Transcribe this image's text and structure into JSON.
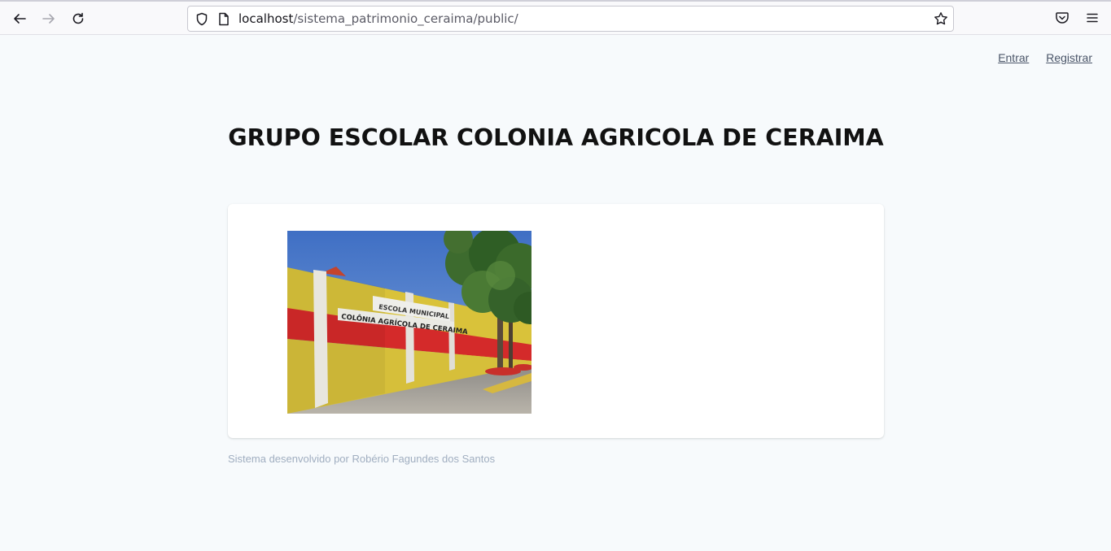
{
  "browser": {
    "url_host": "localhost",
    "url_path": "/sistema_patrimonio_ceraima/public/",
    "icons": {
      "back": "back-arrow-icon",
      "forward": "forward-arrow-icon",
      "reload": "reload-icon",
      "shield": "shield-icon",
      "page": "page-icon",
      "bookmark": "star-icon",
      "pocket": "pocket-icon",
      "menu": "hamburger-menu-icon"
    }
  },
  "nav": {
    "login_label": "Entrar",
    "register_label": "Registrar"
  },
  "main": {
    "title": "GRUPO ESCOLAR COLONIA AGRICOLA DE CERAIMA",
    "photo": {
      "sign_line1": "ESCOLA MUNICIPAL",
      "sign_line2": "COLÔNIA AGRÍCOLA DE CERAIMA"
    }
  },
  "footer": {
    "credit": "Sistema desenvolvido por Robério Fagundes dos Santos"
  },
  "colors": {
    "page_bg": "#f7fafc",
    "link": "#4a5568",
    "footer_text": "#a0aec0",
    "wall_yellow": "#d9c23a",
    "wall_red": "#d42a2a"
  }
}
